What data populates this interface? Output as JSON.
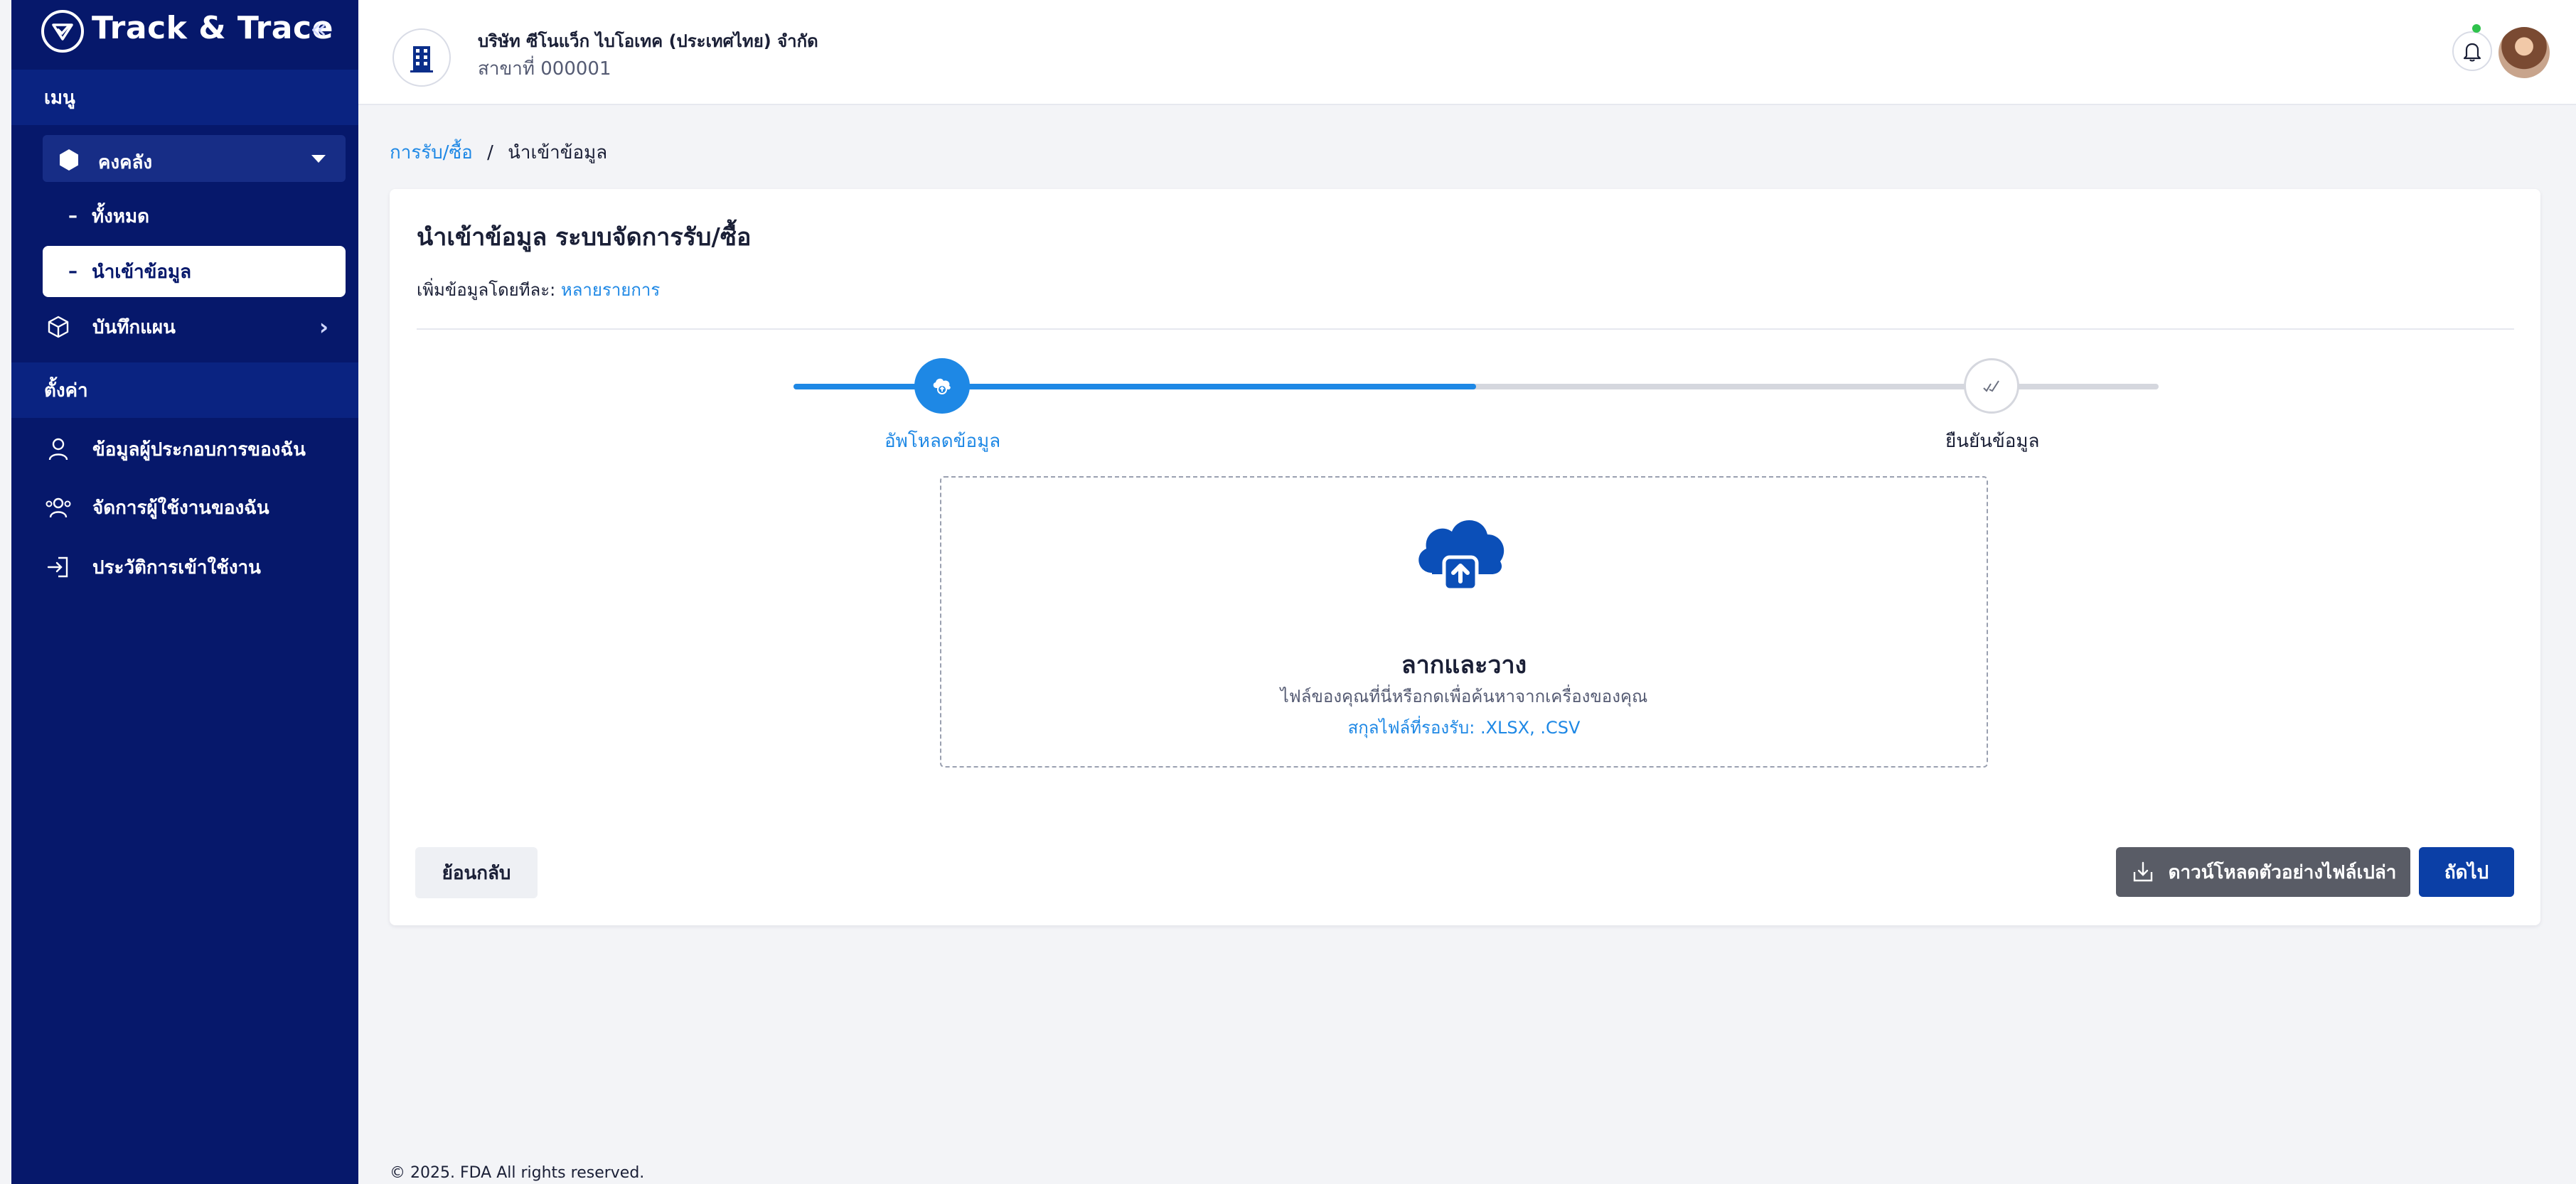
{
  "sidebar": {
    "brand": "Track & Trace",
    "collapse_glyph": "«",
    "menu_header": "เมนู",
    "inventory": {
      "label": "คงคลัง",
      "items": [
        {
          "label": "ทั้งหมด"
        },
        {
          "label": "นำเข้าข้อมูล",
          "active": true
        }
      ]
    },
    "plan_record": "บันทึกแผน",
    "settings_header": "ตั้งค่า",
    "settings_items": [
      {
        "label": "ข้อมูลผู้ประกอบการของฉัน",
        "icon": "user-icon"
      },
      {
        "label": "จัดการผู้ใช้งานของฉัน",
        "icon": "users-icon"
      },
      {
        "label": "ประวัติการเข้าใช้งาน",
        "icon": "login-icon"
      }
    ]
  },
  "header": {
    "company_name": "บริษัท ซีโนแว็ก ไบโอเทค (ประเทศไทย) จำกัด",
    "branch": "สาขาที่ 000001",
    "notification_dot_color": "#2fc24c"
  },
  "breadcrumb": {
    "parent": "การรับ/ซื้อ",
    "separator": "/",
    "current": "นำเข้าข้อมูล"
  },
  "card": {
    "title": "นำเข้าข้อมูล ระบบจัดการรับ/ซื้อ",
    "subtitle_prefix": "เพิ่มข้อมูลโดยทีละ:",
    "subtitle_link": "หลายรายการ",
    "steps": [
      {
        "label": "อัพโหลดข้อมูล",
        "status": "active"
      },
      {
        "label": "ยืนยันข้อมูล",
        "status": "pending"
      }
    ],
    "progress_fraction": 0.5,
    "dropzone": {
      "title": "ลากและวาง",
      "description": "ไฟล์ของคุณที่นี่หรือกดเพื่อค้นหาจากเครื่องของคุณ",
      "supported_types": "สกุลไฟล์ที่รองรับ: .XLSX, .CSV"
    },
    "buttons": {
      "back": "ย้อนกลับ",
      "download_template": "ดาวน์โหลดตัวอย่างไฟล์เปล่า",
      "next": "ถัดไป"
    }
  },
  "footer": "© 2025. FDA All rights reserved.",
  "colors": {
    "sidebar_bg": "#06186b",
    "primary": "#1e88e5",
    "primary_dark": "#0b3fa6"
  }
}
